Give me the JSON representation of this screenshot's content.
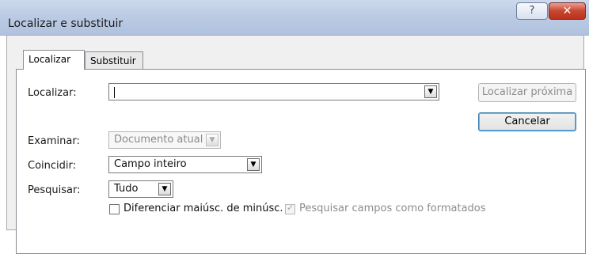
{
  "window": {
    "title": "Localizar e substituir",
    "help": "?",
    "close": "✕"
  },
  "tabs": [
    {
      "label": "Localizar"
    },
    {
      "label": "Substituir"
    }
  ],
  "find": {
    "label": "Localizar:",
    "value": ""
  },
  "search_in": {
    "label": "Examinar:",
    "value": "Documento atual"
  },
  "match": {
    "label": "Coincidir:",
    "value": "Campo inteiro"
  },
  "direction": {
    "label": "Pesquisar:",
    "value": "Tudo"
  },
  "options": {
    "match_case": "Diferenciar maiúsc. de minúsc.",
    "search_formatted": "Pesquisar campos como formatados"
  },
  "buttons": {
    "find_next": "Localizar próxima",
    "cancel": "Cancelar"
  }
}
